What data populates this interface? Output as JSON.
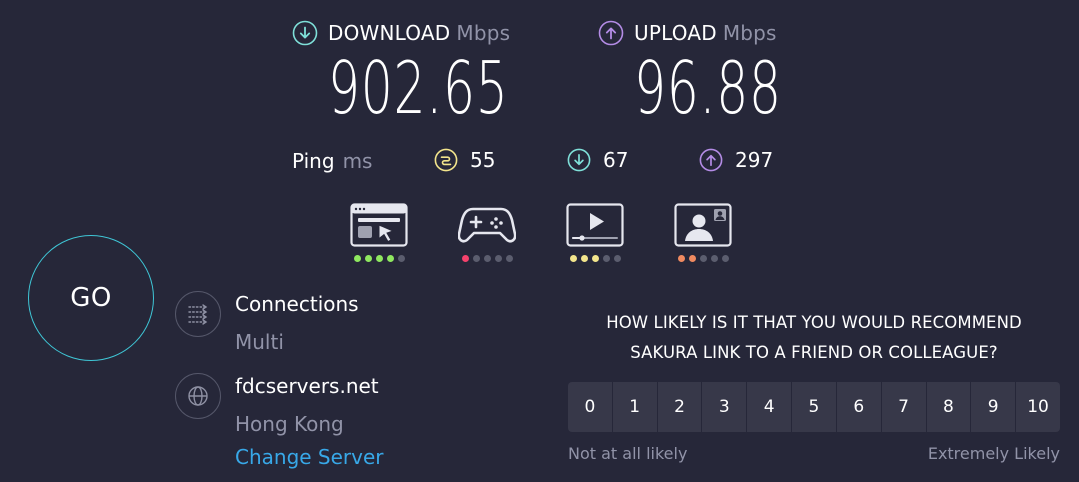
{
  "download": {
    "label": "DOWNLOAD",
    "unit": "Mbps",
    "value": "902.65",
    "icon": "arrow-down-circle-icon",
    "color": "#7fe0d9"
  },
  "upload": {
    "label": "UPLOAD",
    "unit": "Mbps",
    "value": "96.88",
    "icon": "arrow-up-circle-icon",
    "color": "#b48ce6"
  },
  "ping": {
    "label": "Ping",
    "unit": "ms",
    "idle": {
      "value": "55",
      "icon": "jitter-icon",
      "color": "#f3e58c"
    },
    "download": {
      "value": "67",
      "icon": "arrow-down-circle-icon",
      "color": "#7fe0d9"
    },
    "upload": {
      "value": "297",
      "icon": "arrow-up-circle-icon",
      "color": "#b48ce6"
    }
  },
  "activities": [
    {
      "name": "web-browsing",
      "icon": "browser-icon",
      "rating": 4,
      "color": "#8fe85f"
    },
    {
      "name": "gaming",
      "icon": "gamepad-icon",
      "rating": 1,
      "color": "#f5426c"
    },
    {
      "name": "streaming",
      "icon": "video-play-icon",
      "rating": 3,
      "color": "#f3e58c"
    },
    {
      "name": "video-chat",
      "icon": "video-chat-icon",
      "rating": 2,
      "color": "#f08a60"
    }
  ],
  "go_button": {
    "label": "GO",
    "color": "#3fc6d6"
  },
  "connections": {
    "title": "Connections",
    "value": "Multi",
    "icon": "connections-icon"
  },
  "server": {
    "name": "fdcservers.net",
    "location": "Hong Kong",
    "change_label": "Change Server",
    "icon": "globe-icon"
  },
  "nps": {
    "question_line1": "HOW LIKELY IS IT THAT YOU WOULD RECOMMEND",
    "question_line2": "SAKURA LINK TO A FRIEND OR COLLEAGUE?",
    "scale": [
      "0",
      "1",
      "2",
      "3",
      "4",
      "5",
      "6",
      "7",
      "8",
      "9",
      "10"
    ],
    "low_label": "Not at all likely",
    "high_label": "Extremely Likely"
  }
}
